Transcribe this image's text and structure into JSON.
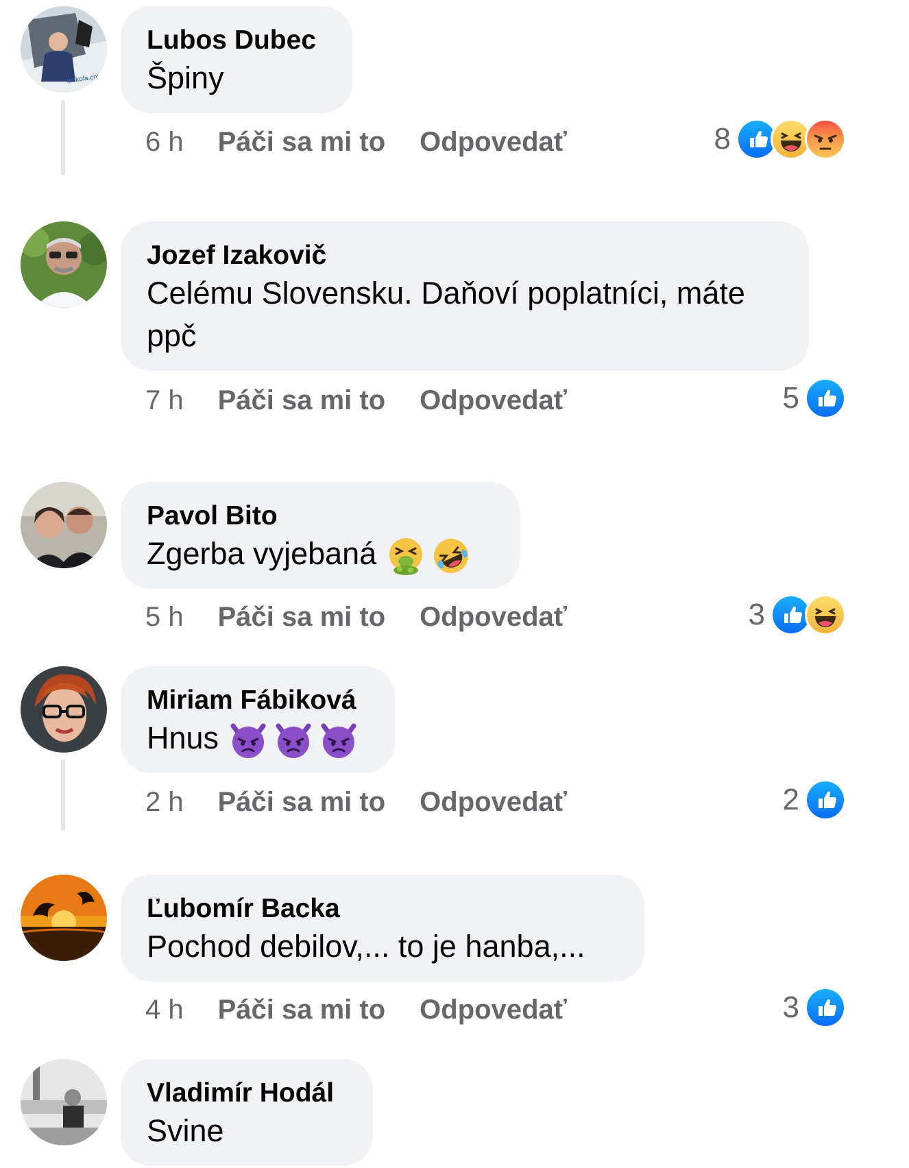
{
  "comments": [
    {
      "author": "Lubos Dubec",
      "text": "Špiny",
      "time": "6 h",
      "like_label": "Páči sa mi to",
      "reply_label": "Odpovedať",
      "reaction_count": "8",
      "reactions": [
        "like-icon",
        "haha-icon",
        "angry-icon"
      ],
      "avatar_caption": "laskola.com"
    },
    {
      "author": "Jozef Izakovič",
      "text_line1": "Celému Slovensku. Daňoví poplatníci, máte",
      "text_line2": "ppč",
      "time": "7 h",
      "like_label": "Páči sa mi to",
      "reply_label": "Odpovedať",
      "reaction_count": "5",
      "reactions": [
        "like-icon"
      ]
    },
    {
      "author": "Pavol Bito",
      "text": "Zgerba vyjebaná",
      "emojis": [
        "vomiting-face-icon",
        "rolling-on-floor-laughing-icon"
      ],
      "time": "5 h",
      "like_label": "Páči sa mi to",
      "reply_label": "Odpovedať",
      "reaction_count": "3",
      "reactions": [
        "like-icon",
        "haha-icon"
      ]
    },
    {
      "author": "Miriam Fábiková",
      "text": "Hnus",
      "emojis": [
        "angry-devil-icon",
        "angry-devil-icon",
        "angry-devil-icon"
      ],
      "time": "2 h",
      "like_label": "Páči sa mi to",
      "reply_label": "Odpovedať",
      "reaction_count": "2",
      "reactions": [
        "like-icon"
      ]
    },
    {
      "author": "Ľubomír Backa",
      "text": "Pochod debilov,... to je hanba,...",
      "time": "4 h",
      "like_label": "Páči sa mi to",
      "reply_label": "Odpovedať",
      "reaction_count": "3",
      "reactions": [
        "like-icon"
      ]
    },
    {
      "author": "Vladimír Hodál",
      "text": "Svine"
    }
  ],
  "colors": {
    "bubble": "#f0f2f5",
    "meta_text": "#65676b",
    "like_blue": "#1877f2",
    "angry_red": "#e9710f",
    "devil_purple": "#7b3fb8"
  }
}
